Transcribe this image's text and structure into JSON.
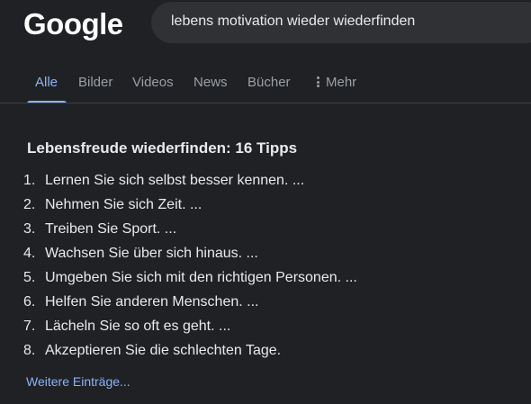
{
  "header": {
    "logo_text": "Google",
    "search_query": "lebens motivation wieder wiederfinden"
  },
  "tabs": [
    {
      "label": "Alle",
      "active": true
    },
    {
      "label": "Bilder",
      "active": false
    },
    {
      "label": "Videos",
      "active": false
    },
    {
      "label": "News",
      "active": false
    },
    {
      "label": "Bücher",
      "active": false
    },
    {
      "label": "Mehr",
      "active": false,
      "icon": "more-vertical-icon"
    }
  ],
  "snippet": {
    "title": "Lebensfreude wiederfinden: 16 Tipps",
    "items": [
      {
        "num": "1.",
        "text": "Lernen Sie sich selbst besser kennen. ..."
      },
      {
        "num": "2.",
        "text": "Nehmen Sie sich Zeit. ..."
      },
      {
        "num": "3.",
        "text": "Treiben Sie Sport. ..."
      },
      {
        "num": "4.",
        "text": "Wachsen Sie über sich hinaus. ..."
      },
      {
        "num": "5.",
        "text": "Umgeben Sie sich mit den richtigen Personen. ..."
      },
      {
        "num": "6.",
        "text": "Helfen Sie anderen Menschen. ..."
      },
      {
        "num": "7.",
        "text": "Lächeln Sie so oft es geht. ..."
      },
      {
        "num": "8.",
        "text": "Akzeptieren Sie die schlechten Tage."
      }
    ],
    "more_link": "Weitere Einträge..."
  },
  "colors": {
    "background": "#202124",
    "search_box": "#303134",
    "text": "#e8eaed",
    "muted": "#9aa0a6",
    "accent": "#8ab4f8"
  }
}
